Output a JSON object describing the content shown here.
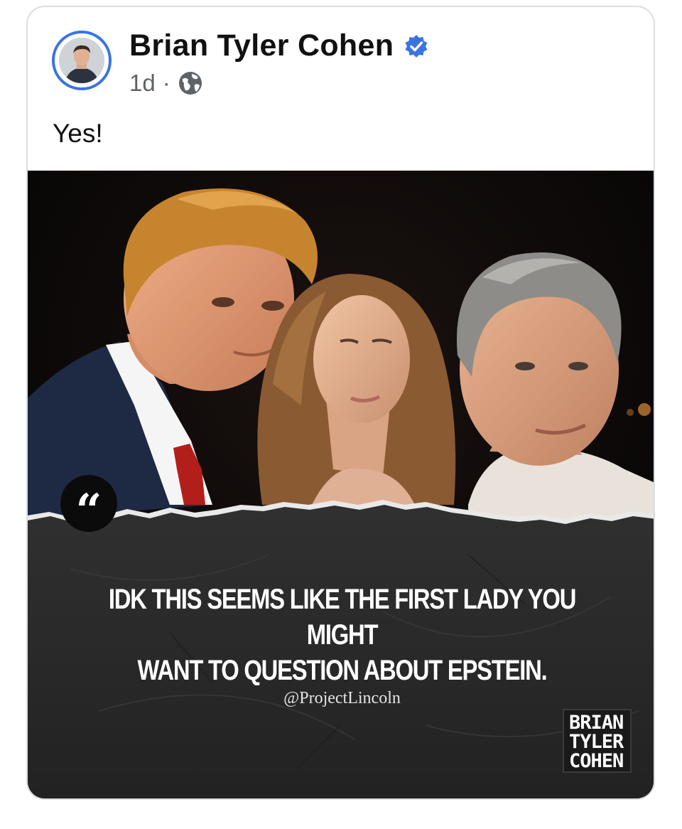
{
  "post": {
    "author": "Brian Tyler Cohen",
    "verified": true,
    "time": "1d",
    "separator": "·",
    "audience_icon": "globe-icon",
    "text": "Yes!"
  },
  "media": {
    "quote_mark": "“",
    "quote_line_1": "IDK THIS SEEMS LIKE THE FIRST LADY YOU MIGHT",
    "quote_line_2": "WANT TO QUESTION ABOUT EPSTEIN.",
    "handle": "@ProjectLincoln",
    "brand_line_1": "BRIAN",
    "brand_line_2": "TYLER",
    "brand_line_3": "COHEN"
  },
  "colors": {
    "verified_blue": "#3b74e0",
    "avatar_ring": "#3b74e0",
    "meta_gray": "#5f6368",
    "quote_panel": "#2b2b2b"
  }
}
